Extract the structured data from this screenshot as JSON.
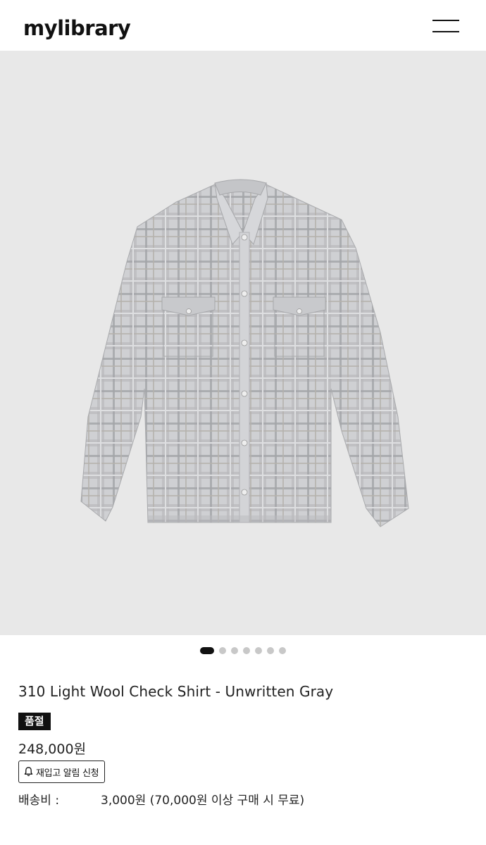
{
  "header": {
    "logo": "mylibrary",
    "menu_icon": "hamburger-menu-icon"
  },
  "product": {
    "image_alt_icon": "shirt-image",
    "title": "310 Light Wool Check Shirt - Unwritten Gray",
    "status_badge": "품절",
    "price": "248,000원",
    "restock_button": {
      "icon": "bell-icon",
      "label": "재입고 알림 신청"
    },
    "shipping": {
      "label": "배송비 :",
      "value": "3,000원 (70,000원 이상 구매 시 무료)"
    }
  },
  "gallery": {
    "total_images": 7,
    "active_index": 0
  },
  "colors": {
    "accent": "#111111",
    "image_bg": "#e8e8e8",
    "shirt": "#c9cacd"
  }
}
